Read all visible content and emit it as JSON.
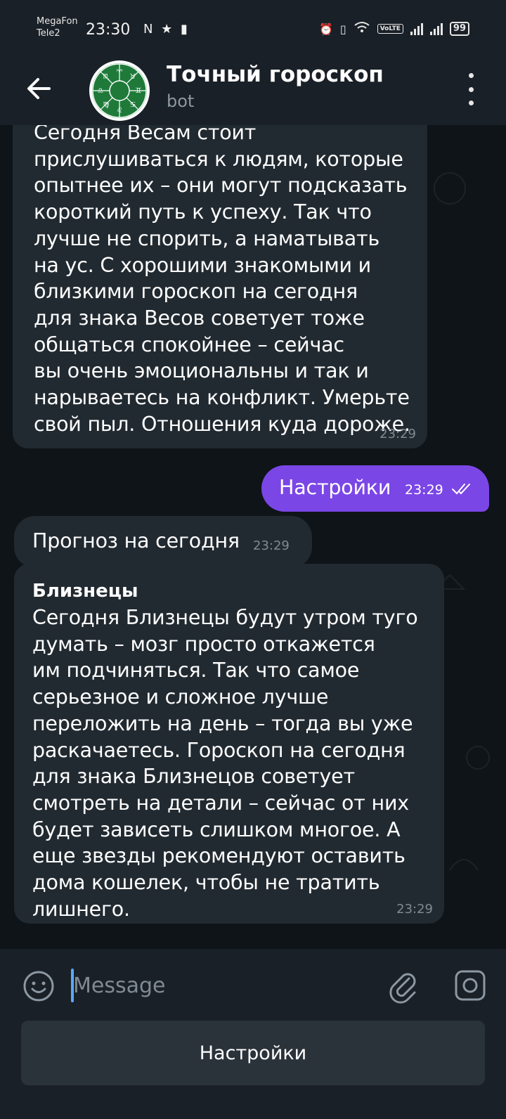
{
  "status_bar": {
    "carrier1": "MegaFon",
    "carrier2": "Tele2",
    "time": "23:30",
    "left_icons": "N ★ ▮",
    "volte": "VoLTE",
    "battery": "99"
  },
  "header": {
    "back_icon": "arrow-left-icon",
    "title": "Точный гороскоп",
    "subtitle": "bot",
    "menu_icon": "more-vertical-icon"
  },
  "messages": [
    {
      "side": "in",
      "text": "Сегодня Весам стоит\nприслушиваться к людям, которые\nопытнее их – они могут подсказать\nкороткий путь к успеху. Так что\nлучше не спорить, а наматывать\nна ус. С хорошими знакомыми и\nблизкими гороскоп на сегодня\nдля знака Весов советует тоже\nобщаться спокойнее – сейчас\nвы очень эмоциональны и так и\nнарываетесь на конфликт. Умерьте\nсвой пыл. Отношения куда дороже.",
      "time": "23:29"
    },
    {
      "side": "out",
      "text": "Настройки",
      "time": "23:29",
      "status_icon": "double-check-icon"
    },
    {
      "side": "in",
      "text": "Прогноз на сегодня",
      "time": "23:29"
    },
    {
      "side": "in",
      "title": "Близнецы",
      "text": "Сегодня Близнецы будут утром туго\nдумать – мозг просто откажется\nим подчиняться. Так что самое\nсерьезное и сложное лучше\nпереложить на день – тогда вы уже\nраскачаетесь. Гороскоп на сегодня\nдля знака Близнецов советует\nсмотреть на детали – сейчас от них\nбудет зависеть слишком многое. А\nеще звезды рекомендуют оставить\nдома кошелек, чтобы не тратить\nлишнего.",
      "time": "23:29"
    }
  ],
  "composer": {
    "placeholder": "Message",
    "value": "",
    "emoji_icon": "emoji-icon",
    "attach_icon": "paperclip-icon",
    "camera_icon": "camera-icon"
  },
  "keyboard": {
    "button_label": "Настройки"
  },
  "colors": {
    "background": "#0f1519",
    "bar": "#1a2027",
    "incoming_bubble": "#222a31",
    "outgoing_bubble": "#7b46e6",
    "avatar_ring": "#1f7a3a"
  }
}
